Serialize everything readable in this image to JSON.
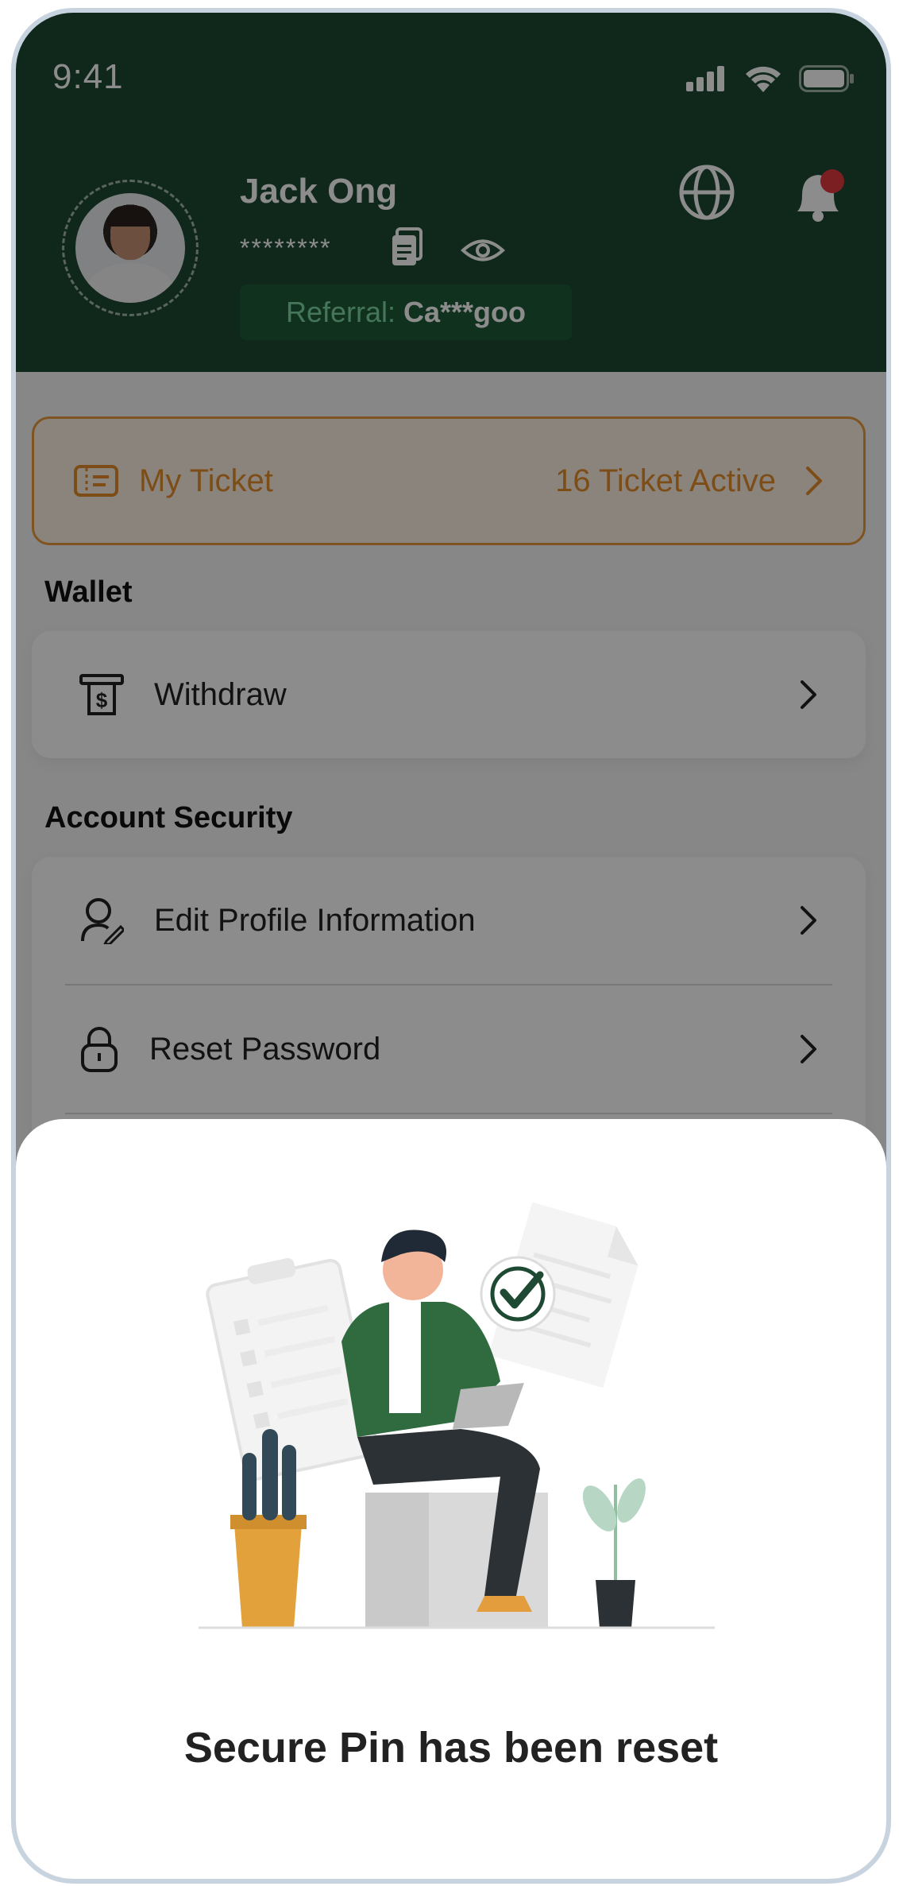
{
  "status_bar": {
    "time": "9:41"
  },
  "profile": {
    "name": "Jack Ong",
    "masked_value": "********",
    "referral_label": "Referral:",
    "referral_code": "Ca***goo"
  },
  "ticket": {
    "label": "My Ticket",
    "count": "16 Ticket Active"
  },
  "wallet": {
    "title": "Wallet",
    "items": [
      {
        "label": "Withdraw",
        "icon": "withdraw-icon"
      }
    ]
  },
  "security": {
    "title": "Account Security",
    "items": [
      {
        "label": "Edit Profile Information",
        "icon": "user-edit-icon"
      },
      {
        "label": "Reset Password",
        "icon": "lock-icon"
      }
    ]
  },
  "sheet": {
    "title": "Secure Pin has been reset"
  },
  "colors": {
    "brand_green": "#1e4a33",
    "accent_orange": "#e48d2a",
    "notification_red": "#e0393e"
  }
}
